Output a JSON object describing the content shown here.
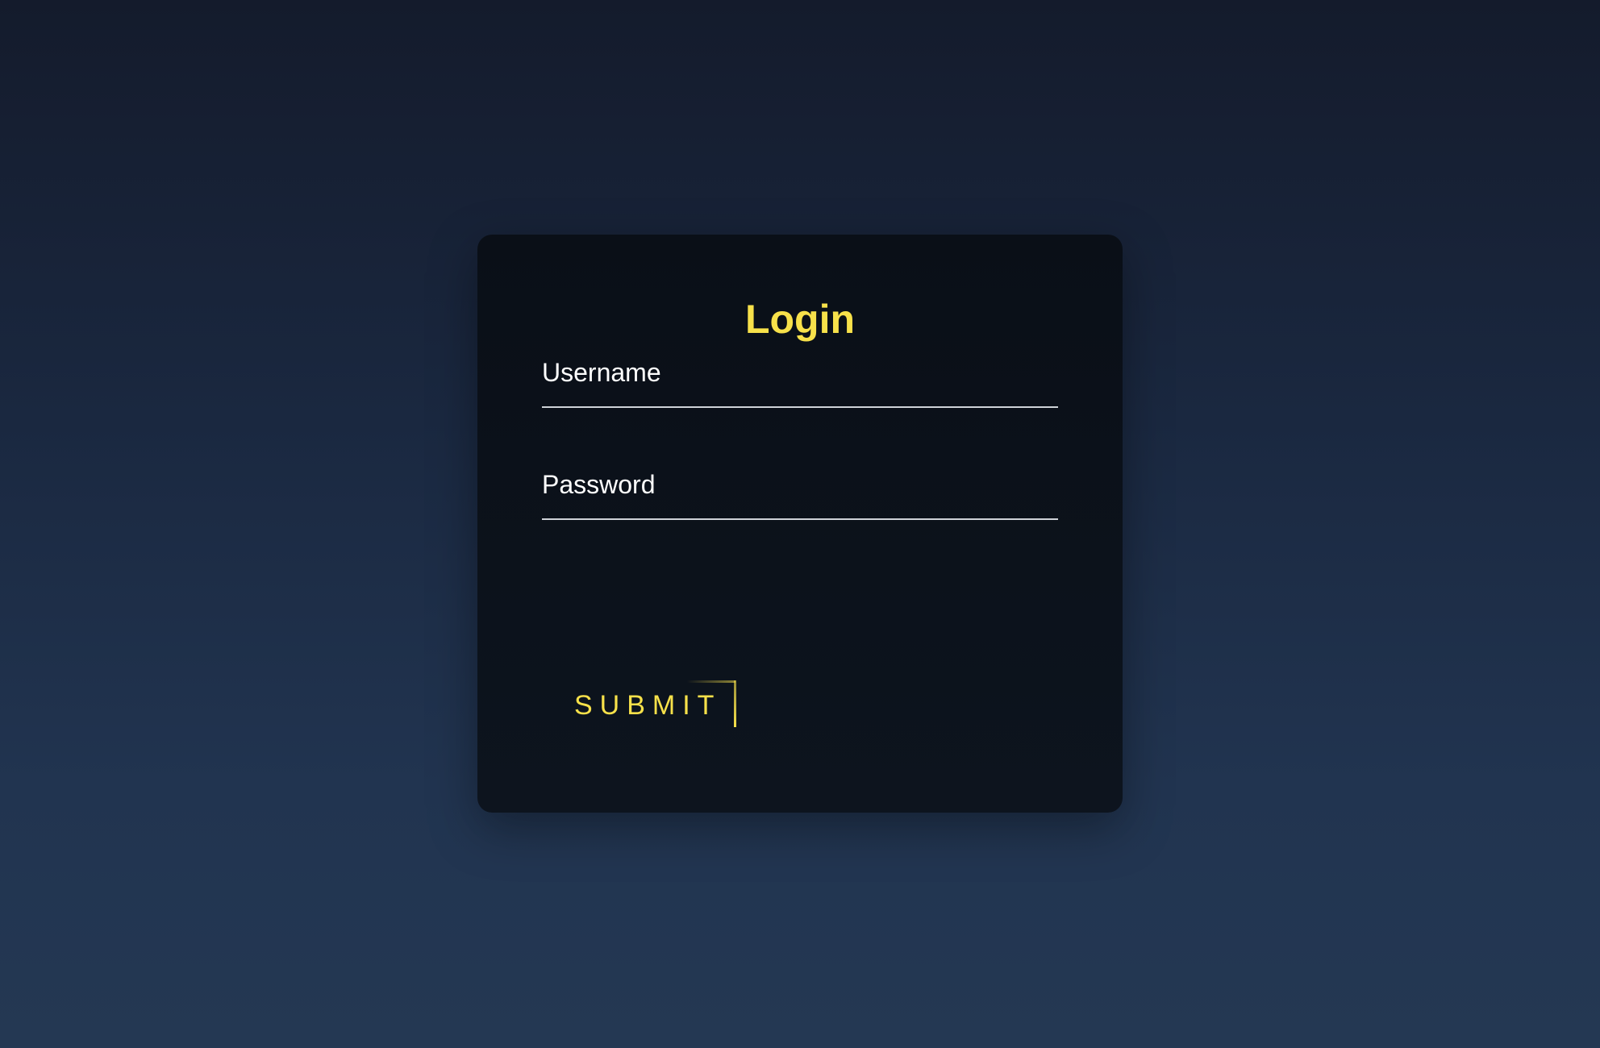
{
  "login_form": {
    "title": "Login",
    "username": {
      "label": "Username",
      "value": ""
    },
    "password": {
      "label": "Password",
      "value": ""
    },
    "submit_label": "SUBMIT"
  },
  "colors": {
    "accent": "#f7e14a",
    "card_background": "#0b1119",
    "page_background_top": "#141b2c",
    "page_background_bottom": "#243853",
    "field_underline": "#cfd3d8",
    "text": "#ffffff"
  }
}
